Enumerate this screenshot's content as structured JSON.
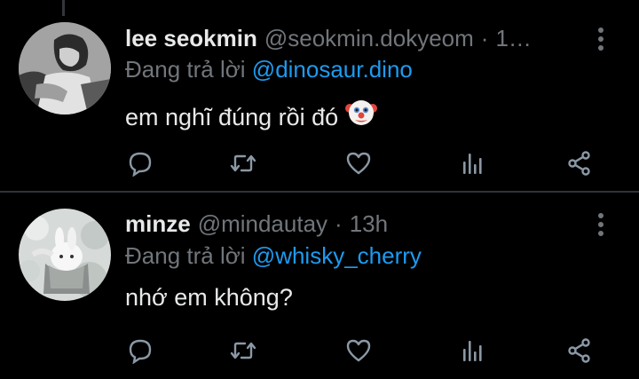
{
  "colors": {
    "background": "#000000",
    "text": "#e7e9ea",
    "secondary": "#71767b",
    "mention": "#1d9bf0",
    "divider": "#2f3336"
  },
  "tweets": [
    {
      "display_name": "lee seokmin",
      "handle": "@seokmin.dokyeom",
      "separator": "·",
      "time": "1…",
      "reply_prefix": "Đang trả lời",
      "reply_to": "@dinosaur.dino",
      "text": "em nghĩ đúng rồi đó",
      "emoji": "clown-face-emoji",
      "avatar": "avatar-seokmin"
    },
    {
      "display_name": "minze",
      "handle": "@mindautay",
      "separator": "·",
      "time": "13h",
      "reply_prefix": "Đang trả lời",
      "reply_to": "@whisky_cherry",
      "text": "nhớ em không?",
      "avatar": "avatar-bunny"
    }
  ],
  "icons": {
    "reply": "reply-icon",
    "retweet": "retweet-icon",
    "like": "heart-icon",
    "views": "views-icon",
    "share": "share-icon",
    "more": "more-vertical-icon"
  }
}
